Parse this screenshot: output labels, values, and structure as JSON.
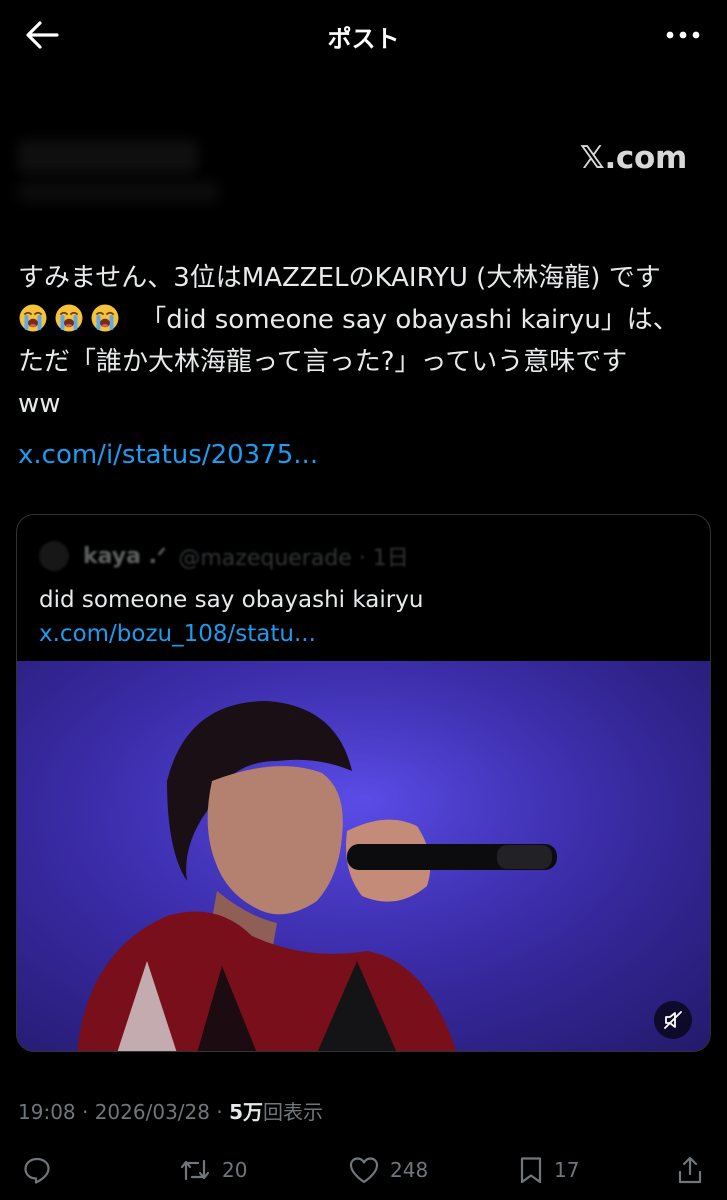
{
  "header": {
    "title": "ポスト",
    "back_icon": "arrow-left-icon",
    "more_icon": "more-horizontal-icon"
  },
  "watermark": "𝕏.com",
  "post": {
    "line1": "すみません、3位はMAZZELのKAIRYU (大林海龍) です",
    "line2_text": "「did someone say obayashi kairyu」は、",
    "line3": "ただ「誰か大林海龍って言った?」っていう意味です",
    "line4": "ww",
    "emoji_count": 3,
    "emoji_icon": "loudly-crying-face-icon",
    "link": "x.com/i/status/20375..."
  },
  "quote": {
    "name": "kaya .ᐟ",
    "handle": "@mazequerade · 1日",
    "text": "did someone say obayashi kairyu",
    "link": "x.com/bozu_108/statu...",
    "media_icon": "muted-speaker-icon"
  },
  "meta": {
    "time": "19:08 · 2026/03/28 · ",
    "views_num": "5万",
    "views_label": "回表示"
  },
  "actions": {
    "reply_icon": "reply-icon",
    "repost_count": "20",
    "like_count": "248",
    "bookmark_count": "17",
    "share_icon": "share-icon"
  },
  "colors": {
    "background": "#000000",
    "link": "#1d9bf0",
    "muted_text": "#71767b",
    "media_bg": "#3a2ba8"
  }
}
